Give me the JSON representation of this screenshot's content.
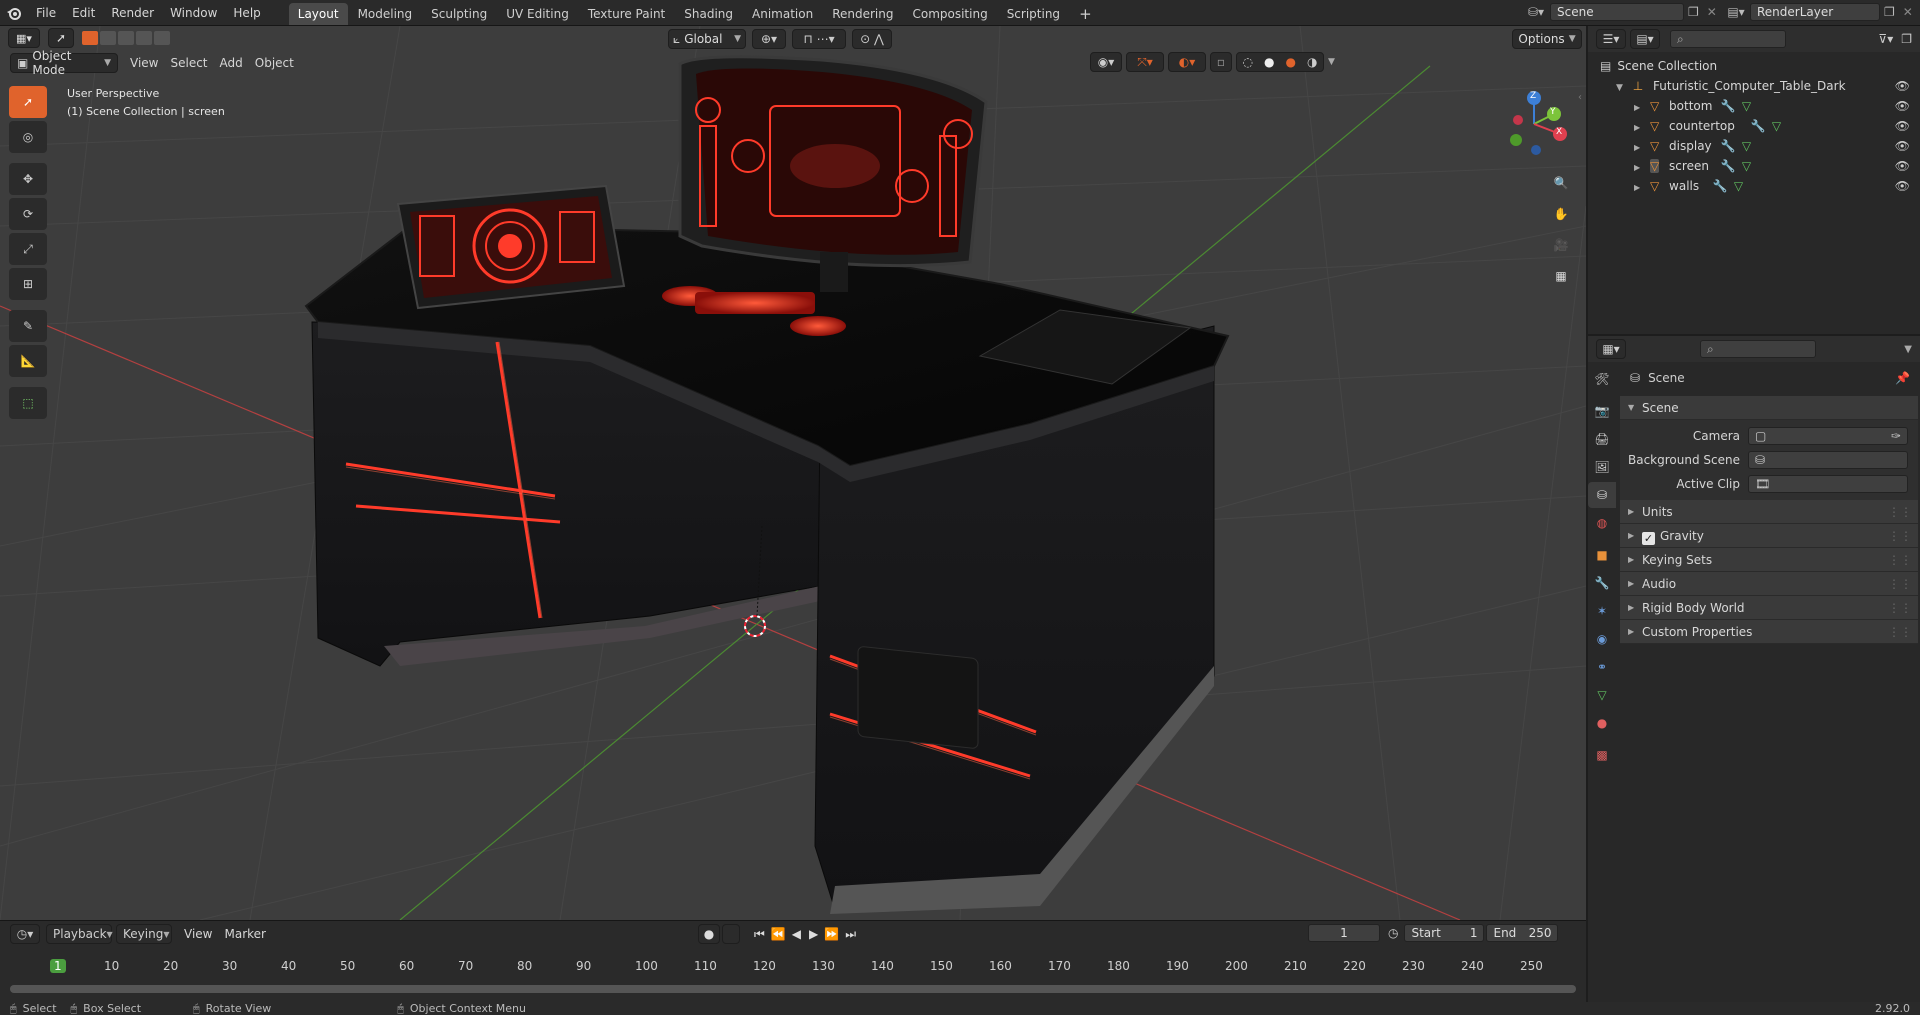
{
  "menubar": {
    "items": [
      "File",
      "Edit",
      "Render",
      "Window",
      "Help"
    ],
    "workspaces": [
      "Layout",
      "Modeling",
      "Sculpting",
      "UV Editing",
      "Texture Paint",
      "Shading",
      "Animation",
      "Rendering",
      "Compositing",
      "Scripting"
    ],
    "add_tab": "+",
    "scene": "Scene",
    "view_layer": "RenderLayer"
  },
  "viewport": {
    "mode": "Object Mode",
    "menus": [
      "View",
      "Select",
      "Add",
      "Object"
    ],
    "transform": "Global",
    "options": "Options",
    "info_line1": "User Perspective",
    "info_line2": "(1) Scene Collection | screen",
    "gizmo": {
      "x": "X",
      "y": "Y",
      "z": "Z"
    }
  },
  "outliner": {
    "root": "Scene Collection",
    "collection": "Futuristic_Computer_Table_Dark",
    "objects": [
      "bottom",
      "countertop",
      "display",
      "screen",
      "walls"
    ]
  },
  "properties": {
    "breadcrumb": "Scene",
    "section": "Scene",
    "fields": [
      {
        "label": "Camera",
        "value": ""
      },
      {
        "label": "Background Scene",
        "value": ""
      },
      {
        "label": "Active Clip",
        "value": ""
      }
    ],
    "panels": [
      "Units",
      "Gravity",
      "Keying Sets",
      "Audio",
      "Rigid Body World",
      "Custom Properties"
    ],
    "gravity_checked": true
  },
  "timeline": {
    "menus": [
      "Playback",
      "Keying",
      "View",
      "Marker"
    ],
    "current_frame": "1",
    "start_label": "Start",
    "start": "1",
    "end_label": "End",
    "end": "250",
    "ticks": [
      "1",
      "10",
      "20",
      "30",
      "40",
      "50",
      "60",
      "70",
      "80",
      "90",
      "100",
      "110",
      "120",
      "130",
      "140",
      "150",
      "160",
      "170",
      "180",
      "190",
      "200",
      "210",
      "220",
      "230",
      "240",
      "250"
    ]
  },
  "statusbar": {
    "select": "Select",
    "box_select": "Box Select",
    "rotate": "Rotate View",
    "context": "Object Context Menu",
    "version": "2.92.0"
  },
  "colors": {
    "accent": "#e0632c",
    "active_tool": "#e0632c",
    "neon_red": "#ff3b2a",
    "x_axis": "#e0404f",
    "y_axis": "#7cc43a",
    "z_axis": "#3d7fd6"
  }
}
